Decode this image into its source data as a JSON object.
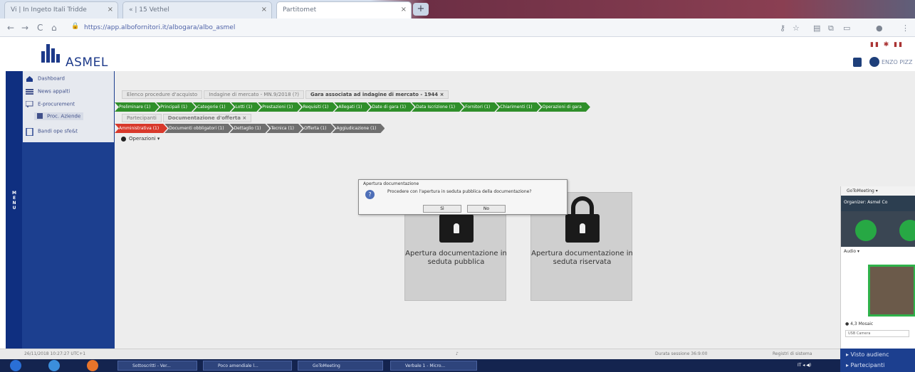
{
  "browser": {
    "tabs": [
      {
        "label": "Vi  | In Ingeto Itali Tridde",
        "active": false
      },
      {
        "label": "« | 15  Vethel",
        "active": false
      },
      {
        "label": "Partitomet",
        "active": true
      }
    ],
    "new_tab": "+",
    "url": "https://app.albofornitori.it/albogara/albo_asmel",
    "nav": {
      "back": "←",
      "forward": "→",
      "reload": "C",
      "home": "⌂"
    }
  },
  "header": {
    "logo_text": "ASMEL",
    "flags": "▮▮ ✱ ▮▮",
    "user_name": "ENZO PIZZ"
  },
  "menu_strip": {
    "label": "MENU"
  },
  "sidebar": {
    "items": [
      {
        "label": "Dashboard",
        "icon": "home-icon"
      },
      {
        "label": "News appalti",
        "icon": "news-icon"
      },
      {
        "label": "E-procurement",
        "icon": "cart-icon"
      },
      {
        "label": "Proc. Aziende",
        "icon": "list-icon"
      },
      {
        "label": "Bandi ope sfe&t",
        "icon": "doc-icon"
      }
    ]
  },
  "breadcrumb": {
    "items": [
      "Elenco procedure d'acquisto",
      "Indagine di mercato - MN.9/2018 (?)"
    ],
    "current": "Gara associata ad indagine di mercato - 1944 ×"
  },
  "tabs_row1": [
    "Preliminare (1)",
    "Principali (1)",
    "Categorie (1)",
    "Lotti (1)",
    "Prestazioni (1)",
    "Requisiti (1)",
    "Allegati (1)",
    "Date di gara (1)",
    "Data Iscrizione (1)",
    "Fornitori (1)",
    "Chiarimenti (1)",
    "Operazioni di gara"
  ],
  "subcrumb": {
    "item": "Partecipanti",
    "current": "Documentazione d'offerta ×"
  },
  "tabs_row3": [
    {
      "label": "Amministrativa (1)",
      "color": "r"
    },
    {
      "label": "Documenti obbligatori (1)",
      "color": "gy"
    },
    {
      "label": "Dettaglio (1)",
      "color": "gy"
    },
    {
      "label": "Tecnica (1)",
      "color": "gy"
    },
    {
      "label": "Offerta (1)",
      "color": "gy"
    },
    {
      "label": "Aggiudicazione (1)",
      "color": "gy"
    }
  ],
  "operations": {
    "label": "Operazioni ▾"
  },
  "dialog": {
    "title": "Apertura documentazione",
    "message": "Procedere con l'apertura in seduta pubblica della documentazione?",
    "ok": "Sì",
    "cancel": "No"
  },
  "tiles": [
    {
      "label": "Apertura documentazione in seduta pubblica"
    },
    {
      "label": "Apertura documentazione in seduta riservata"
    }
  ],
  "meeting": {
    "header": "GoToMeeting ▾",
    "subheader": "Organizer: Asmel Co",
    "audio_label": "Audio ▾",
    "camera_label": "● 4,3 Mosaic",
    "camera_select": "USB Camera",
    "footer": [
      "▸  Visto audienc",
      "▸  Partecipanti"
    ]
  },
  "status": {
    "left": "26/11/2018 10:27:27 UTC+1",
    "center": "Durata sessione 36:9:00",
    "right": "Registri di sistema"
  },
  "taskbar": {
    "items": [
      "Sottoscritti - Ver...",
      "Poco amendiale l...",
      "GoToMeeting",
      "Verbale 1 - Micro..."
    ],
    "clock": "IT  ◂  ◀)"
  },
  "colors": {
    "brand": "#1c3f8f",
    "green_tab": "#2f8f2a",
    "red_tab": "#d8392b",
    "meeting_green": "#27a844"
  }
}
